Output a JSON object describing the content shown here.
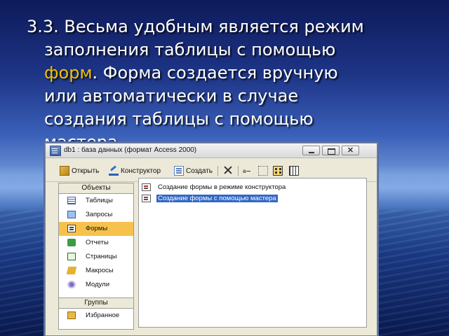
{
  "slide": {
    "line1": "3.3. Весьма удобным является режим",
    "line2": "заполнения таблицы с помощью",
    "line3_highlight": "форм",
    "line3_rest": ". Форма создается вручную",
    "line4": "или автоматически в случае",
    "line5": "создания таблицы с помощью",
    "line6": "мастера.",
    "highlight_color": "#f0c000"
  },
  "window": {
    "title": "db1 : база данных (формат Access 2000)",
    "close_glyph": "✕"
  },
  "toolbar": {
    "open_label": "Открыть",
    "design_label": "Конструктор",
    "new_label": "Создать",
    "small_icons_label": "a"
  },
  "nav": {
    "objects_header": "Объекты",
    "items": [
      {
        "label": "Таблицы",
        "icon": "table-icon"
      },
      {
        "label": "Запросы",
        "icon": "query-icon"
      },
      {
        "label": "Формы",
        "icon": "form-icon",
        "selected": true
      },
      {
        "label": "Отчеты",
        "icon": "report-icon"
      },
      {
        "label": "Страницы",
        "icon": "page-icon"
      },
      {
        "label": "Макросы",
        "icon": "macro-icon"
      },
      {
        "label": "Модули",
        "icon": "module-icon"
      }
    ],
    "groups_header": "Группы",
    "groups": [
      {
        "label": "Избранное",
        "icon": "favorites-icon"
      }
    ]
  },
  "list": {
    "items": [
      {
        "label": "Создание формы в режиме конструктора",
        "selected": false
      },
      {
        "label": "Создание формы с помощью мастера",
        "selected": true
      }
    ]
  },
  "colors": {
    "selection_blue": "#3168c6",
    "nav_selected": "#f6c24c"
  }
}
